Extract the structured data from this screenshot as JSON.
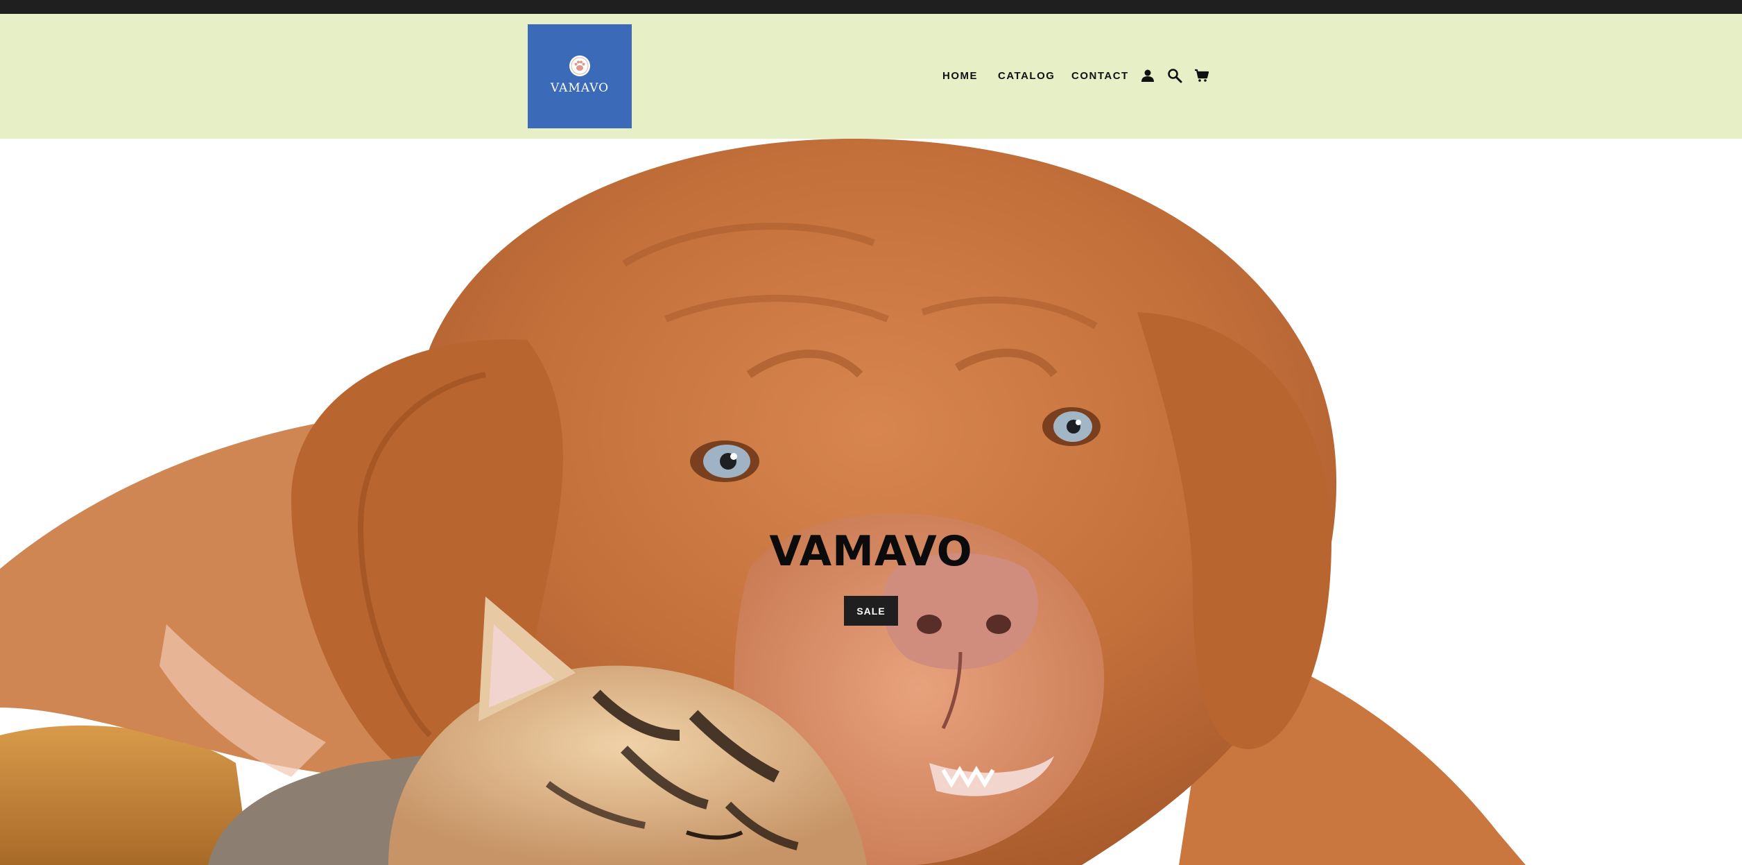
{
  "header": {
    "logo_text": "VAMAVO",
    "background_color": "#e6efc6",
    "logo_bg_color": "#3b6ab8"
  },
  "nav": {
    "items": [
      {
        "label": "HOME"
      },
      {
        "label": "CATALOG"
      },
      {
        "label": "CONTACT"
      }
    ],
    "icons": [
      "account-icon",
      "search-icon",
      "cart-icon"
    ]
  },
  "hero": {
    "title": "VAMAVO",
    "button_label": "SALE",
    "image": "puppy-and-kitten-photo"
  }
}
